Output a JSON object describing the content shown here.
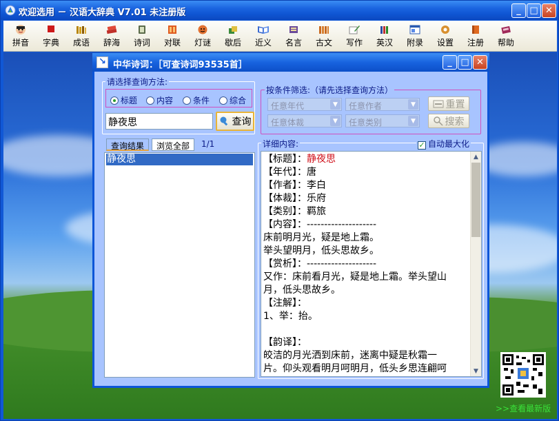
{
  "window": {
    "title": "欢迎选用 － 汉语大辞典 V7.01 未注册版",
    "controls": {
      "minimize": "_",
      "maximize": "□",
      "close": "✕"
    }
  },
  "toolbar": {
    "items": [
      {
        "label": "拼音",
        "icon": "pinyin-face-icon"
      },
      {
        "label": "字典",
        "icon": "red-book-icon"
      },
      {
        "label": "成语",
        "icon": "book-stack-icon"
      },
      {
        "label": "辞海",
        "icon": "red-books-icon"
      },
      {
        "label": "诗词",
        "icon": "scroll-icon"
      },
      {
        "label": "对联",
        "icon": "couplet-icon"
      },
      {
        "label": "灯谜",
        "icon": "lantern-icon"
      },
      {
        "label": "歇后",
        "icon": "notes-icon"
      },
      {
        "label": "近义",
        "icon": "open-book-icon"
      },
      {
        "label": "名言",
        "icon": "quote-book-icon"
      },
      {
        "label": "古文",
        "icon": "bamboo-slips-icon"
      },
      {
        "label": "写作",
        "icon": "pencil-paper-icon"
      },
      {
        "label": "英汉",
        "icon": "bookshelf-icon"
      },
      {
        "label": "附录",
        "icon": "appendix-window-icon"
      },
      {
        "label": "设置",
        "icon": "gear-person-icon"
      },
      {
        "label": "注册",
        "icon": "register-book-icon"
      },
      {
        "label": "帮助",
        "icon": "help-book-icon"
      }
    ]
  },
  "dialog": {
    "title": "中华诗词：［可查诗词93535首］",
    "icon_glyph": "↘",
    "query_method": {
      "legend": "请选择查询方法:",
      "options": [
        {
          "label": "标题",
          "selected": true
        },
        {
          "label": "内容",
          "selected": false
        },
        {
          "label": "条件",
          "selected": false
        },
        {
          "label": "综合",
          "selected": false
        }
      ],
      "search_value": "静夜思",
      "query_button": "查询"
    },
    "filter": {
      "legend": "按条件筛选:（请先选择查询方法）",
      "era_placeholder": "任意年代",
      "author_placeholder": "任意作者",
      "genre_placeholder": "任意体裁",
      "category_placeholder": "任意类别",
      "reset_button": "重置",
      "search_button": "搜索"
    },
    "results": {
      "tab_results": "查询结果",
      "tab_browse": "浏览全部",
      "page_indicator": "1/1",
      "items": [
        "静夜思"
      ]
    },
    "detail": {
      "legend": "详细内容:",
      "auto_maximize_label": "自动最大化",
      "auto_maximize_checked": true,
      "lines": [
        {
          "prefix": "【标题】：",
          "value": "静夜思",
          "red": true
        },
        {
          "prefix": "【年代】：",
          "value": "唐"
        },
        {
          "prefix": "【作者】：",
          "value": "李白"
        },
        {
          "prefix": "【体裁】：",
          "value": "乐府"
        },
        {
          "prefix": "【类别】：",
          "value": "羁旅"
        },
        {
          "prefix": "【内容】：",
          "value": "--------------------"
        },
        {
          "prefix": "",
          "value": "床前明月光，疑是地上霜。"
        },
        {
          "prefix": "",
          "value": "举头望明月，低头思故乡。"
        },
        {
          "prefix": "【赏析】：",
          "value": "--------------------"
        },
        {
          "prefix": "",
          "value": "又作：床前看月光，疑是地上霜。举头望山"
        },
        {
          "prefix": "",
          "value": "月，低头思故乡。"
        },
        {
          "prefix": "【注解】：",
          "value": ""
        },
        {
          "prefix": "",
          "value": "1、举：抬。"
        },
        {
          "prefix": "",
          "value": ""
        },
        {
          "prefix": "【韵译】：",
          "value": ""
        },
        {
          "prefix": "",
          "value": "皎洁的月光洒到床前，迷离中疑是秋霜一"
        },
        {
          "prefix": "",
          "value": "片。仰头观看明月呵明月，低头乡思连翩呵"
        }
      ]
    }
  },
  "promo": {
    "link_text": ">>查看最新版"
  }
}
